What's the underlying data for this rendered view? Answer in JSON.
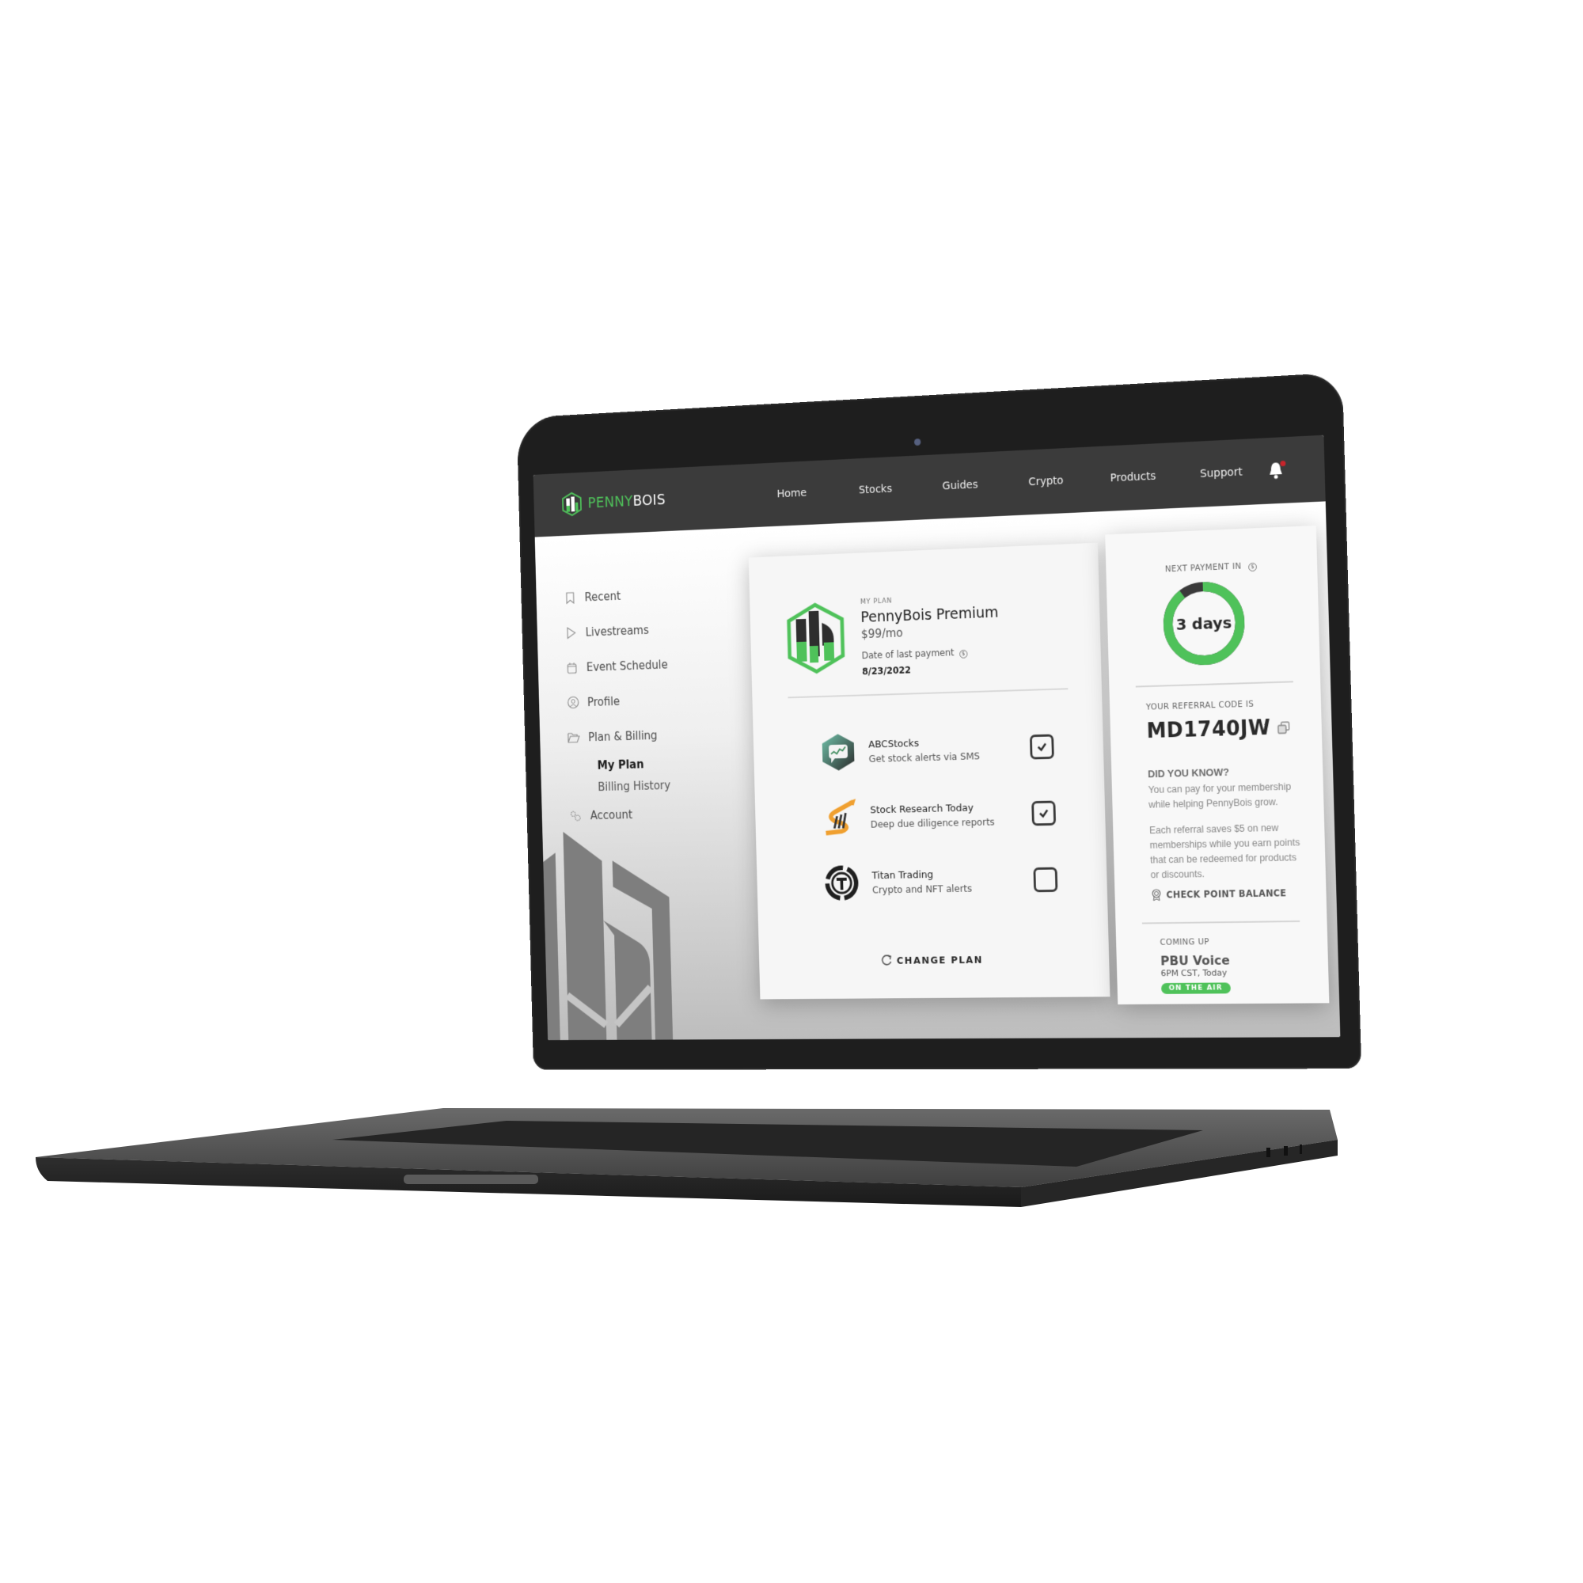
{
  "brand": {
    "name_part1": "PENNY",
    "name_part2": "BOIS",
    "accent_color": "#4fc25a"
  },
  "nav": {
    "links": [
      {
        "label": "Home"
      },
      {
        "label": "Stocks"
      },
      {
        "label": "Guides"
      },
      {
        "label": "Crypto"
      },
      {
        "label": "Products"
      },
      {
        "label": "Support"
      }
    ],
    "notification_icon": "bell-icon",
    "has_unread_notification": true
  },
  "sidebar": {
    "items": [
      {
        "label": "Recent",
        "icon": "bookmark-icon"
      },
      {
        "label": "Livestreams",
        "icon": "play-icon"
      },
      {
        "label": "Event Schedule",
        "icon": "calendar-icon"
      },
      {
        "label": "Profile",
        "icon": "user-circle-icon"
      },
      {
        "label": "Plan & Billing",
        "icon": "folder-open-icon",
        "children": [
          {
            "label": "My Plan",
            "active": true
          },
          {
            "label": "Billing History",
            "active": false
          }
        ]
      },
      {
        "label": "Account",
        "icon": "gears-icon"
      }
    ]
  },
  "plan": {
    "section_label": "MY PLAN",
    "name": "PennyBois Premium",
    "price": "$99/mo",
    "last_payment_label": "Date of last payment",
    "last_payment_date": "8/23/2022",
    "addons": [
      {
        "name": "ABCStocks",
        "description": "Get stock alerts via SMS",
        "checked": true
      },
      {
        "name": "Stock Research Today",
        "description": "Deep due diligence reports",
        "checked": true
      },
      {
        "name": "Titan Trading",
        "description": "Crypto and NFT alerts",
        "checked": false
      }
    ],
    "change_plan_label": "CHANGE PLAN"
  },
  "next_payment": {
    "label": "NEXT PAYMENT IN",
    "value_text": "3 days",
    "elapsed_fraction": 0.9,
    "ring_color": "#4fc25a",
    "remaining_color": "#3a3a3a"
  },
  "referral": {
    "label": "YOUR REFERRAL CODE IS",
    "code": "MD1740JW",
    "did_you_know_title": "DID YOU KNOW?",
    "paragraph1": "You can pay for your membership while helping PennyBois grow.",
    "paragraph2": "Each referral saves $5 on new memberships while you earn points that can be redeemed for products or discounts.",
    "check_points_label": "CHECK POINT BALANCE"
  },
  "coming_up": {
    "label": "COMING UP",
    "title": "PBU Voice",
    "time": "6PM CST, Today",
    "badge": "ON THE AIR"
  }
}
